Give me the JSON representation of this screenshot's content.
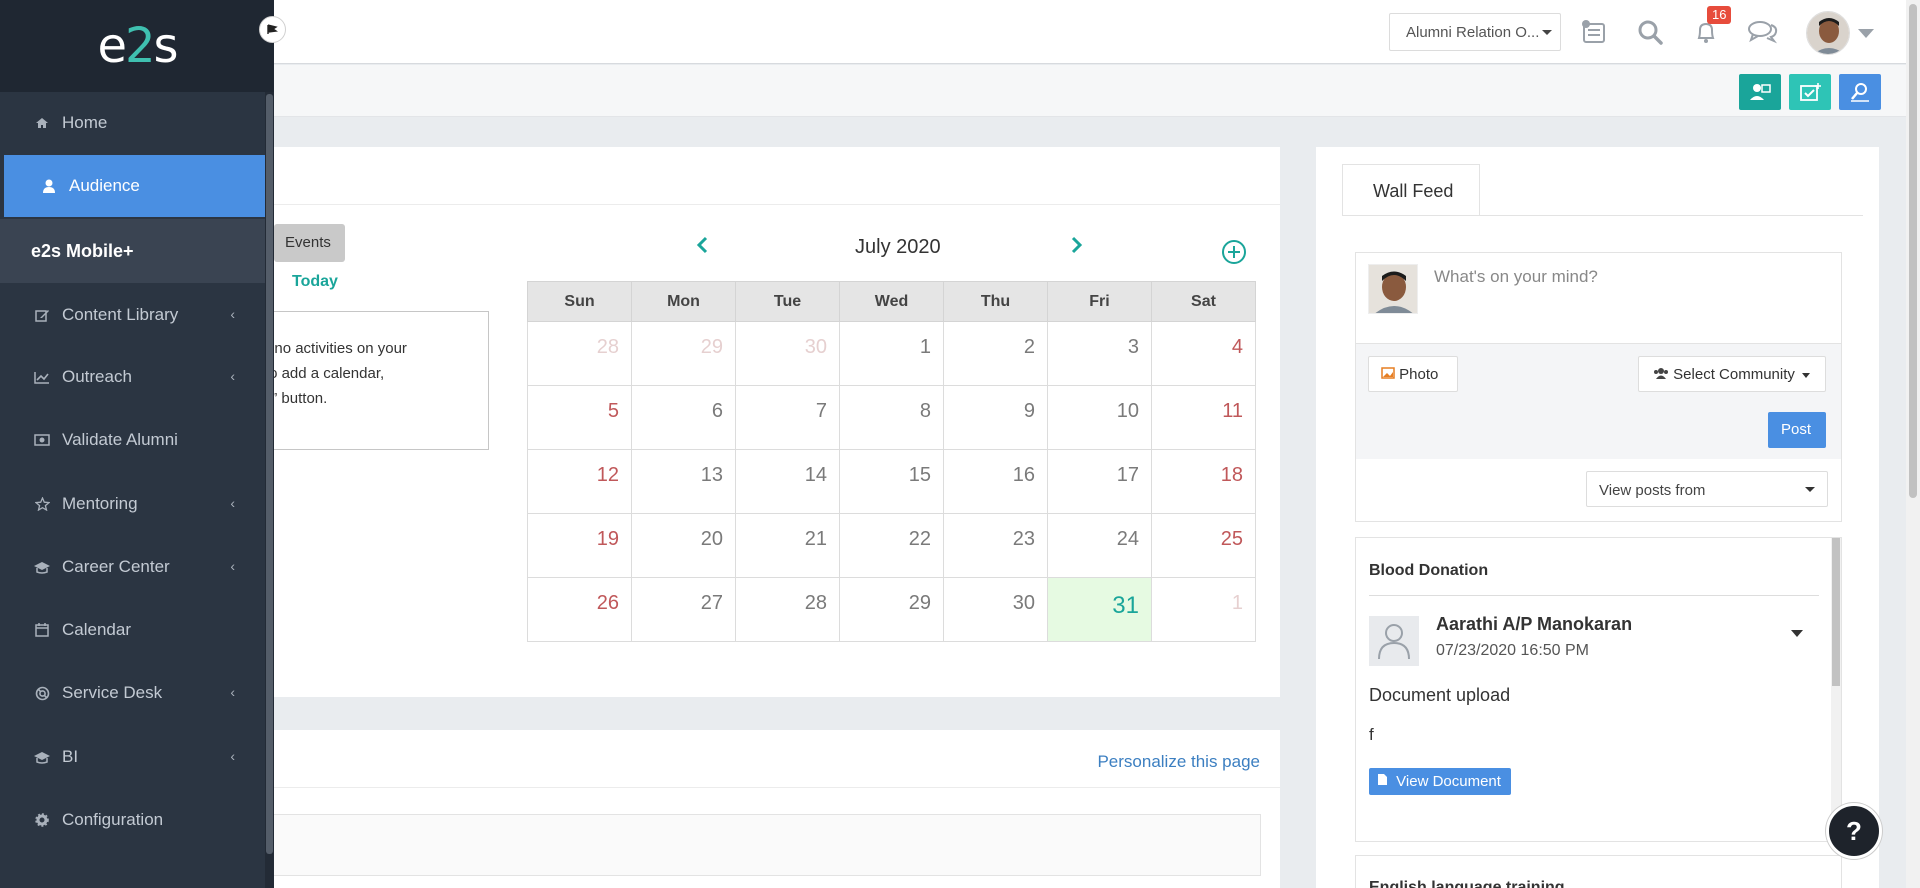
{
  "sidebar": {
    "logo": {
      "pre": "e",
      "accent": "2",
      "post": "s"
    },
    "items": [
      {
        "label": "Home",
        "icon": "home-icon",
        "has_arrow": false
      },
      {
        "label": "Audience",
        "icon": "user-icon",
        "active": true
      },
      {
        "label": "e2s Mobile+",
        "section": true
      },
      {
        "label": "Content Library",
        "icon": "edit-icon",
        "has_arrow": true
      },
      {
        "label": "Outreach",
        "icon": "line-chart-icon",
        "has_arrow": true
      },
      {
        "label": "Validate Alumni",
        "icon": "money-icon",
        "has_arrow": false
      },
      {
        "label": "Mentoring",
        "icon": "star-icon",
        "has_arrow": true
      },
      {
        "label": "Career Center",
        "icon": "graduation-cap-icon",
        "has_arrow": true
      },
      {
        "label": "Calendar",
        "icon": "calendar-icon",
        "has_arrow": false
      },
      {
        "label": "Service Desk",
        "icon": "life-ring-icon",
        "has_arrow": true
      },
      {
        "label": "BI",
        "icon": "graduation-cap-icon",
        "has_arrow": true
      },
      {
        "label": "Configuration",
        "icon": "gear-icon",
        "has_arrow": false
      }
    ]
  },
  "header": {
    "role_select": "Alumni Relation O...",
    "notifications_count": "16"
  },
  "calendar": {
    "events_button": "Events",
    "today_link": "Today",
    "no_activities_lines": [
      "ave no activities on your",
      "y! To add a calendar,",
      "e “+” button."
    ],
    "month": "July 2020",
    "weekdays": [
      "Sun",
      "Mon",
      "Tue",
      "Wed",
      "Thu",
      "Fri",
      "Sat"
    ],
    "weeks": [
      [
        "28",
        "29",
        "30",
        "1",
        "2",
        "3",
        "4"
      ],
      [
        "5",
        "6",
        "7",
        "8",
        "9",
        "10",
        "11"
      ],
      [
        "12",
        "13",
        "14",
        "15",
        "16",
        "17",
        "18"
      ],
      [
        "19",
        "20",
        "21",
        "22",
        "23",
        "24",
        "25"
      ],
      [
        "26",
        "27",
        "28",
        "29",
        "30",
        "31",
        "1"
      ]
    ],
    "today_value": "31"
  },
  "personalize": {
    "link": "Personalize this page"
  },
  "wall": {
    "tab": "Wall Feed",
    "placeholder": "What's on your mind?",
    "photo_button": "Photo",
    "community_button": "Select Community",
    "post_button": "Post",
    "view_posts_from": "View posts from",
    "posts": [
      {
        "title": "Blood Donation",
        "author": "Aarathi A/P Manokaran",
        "date": "07/23/2020 16:50 PM",
        "body": "Document upload",
        "extra": "f",
        "action": "View Document"
      }
    ],
    "next_title": "English language training"
  },
  "help": {
    "label": "?"
  },
  "colors": {
    "sidebar_bg": "#2b3542",
    "active": "#4a8fe2",
    "teal": "#1aa59a",
    "weekend": "#c0585a",
    "badge": "#e74c3c"
  }
}
